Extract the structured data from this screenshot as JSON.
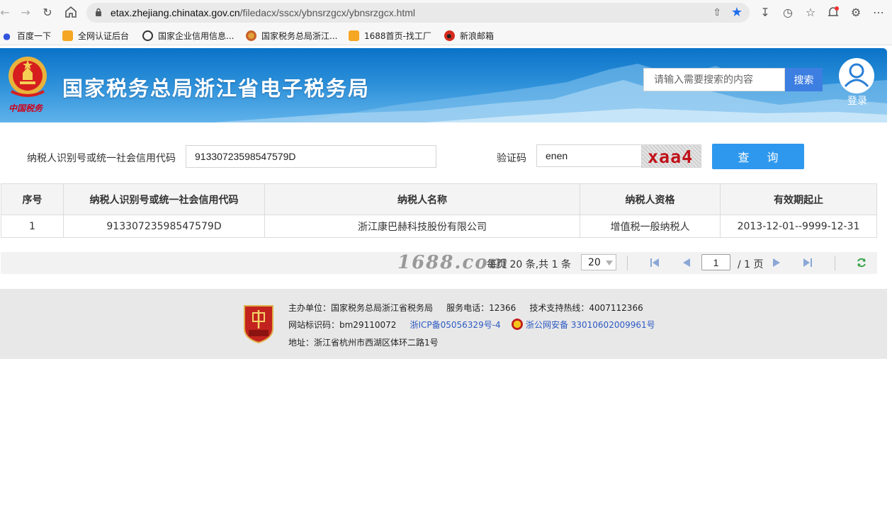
{
  "browser": {
    "url_host": "etax.zhejiang.chinatax.gov.cn",
    "url_path": "/filedacx/sscx/ybnsrzgcx/ybnsrzgcx.html",
    "nav_icons": [
      "back-icon",
      "forward-icon",
      "reload-icon",
      "home-icon"
    ],
    "toolbar_icons": [
      "download-icon",
      "history-icon",
      "favorites-icon",
      "notifications-icon",
      "extensions-icon",
      "more-icon"
    ],
    "bookmarks": [
      {
        "label": "百度一下",
        "icon": "baidu-icon",
        "color": "#3355dd"
      },
      {
        "label": "全网认证后台",
        "icon": "alibaba-icon",
        "color": "#f5a623"
      },
      {
        "label": "国家企业信用信息...",
        "icon": "globe-icon",
        "color": "#333333"
      },
      {
        "label": "国家税务总局浙江...",
        "icon": "tax-emblem-icon",
        "color": "#c8612a"
      },
      {
        "label": "1688首页-找工厂",
        "icon": "alibaba-icon",
        "color": "#f5a623"
      },
      {
        "label": "新浪邮箱",
        "icon": "weibo-icon",
        "color": "#d52b1e"
      }
    ]
  },
  "header": {
    "emblem_text": "中国税务",
    "title": "国家税务总局浙江省电子税务局",
    "search_placeholder": "请输入需要搜索的内容",
    "search_button": "搜索",
    "login_label": "登录"
  },
  "form": {
    "tax_id_label": "纳税人识别号或统一社会信用代码",
    "tax_id_value": "91330723598547579D",
    "captcha_label": "验证码",
    "captcha_value": "enen",
    "captcha_image_text": "xaa4",
    "query_button": "查 询"
  },
  "table": {
    "headers": [
      "序号",
      "纳税人识别号或统一社会信用代码",
      "纳税人名称",
      "纳税人资格",
      "有效期起止"
    ],
    "rows": [
      [
        "1",
        "91330723598547579D",
        "浙江康巴赫科技股份有限公司",
        "增值税一般纳税人",
        "2013-12-01--9999-12-31"
      ]
    ]
  },
  "pager": {
    "watermark": "1688.com",
    "info": "每页 20 条,共 1 条",
    "page_size": "20",
    "current_page": "1",
    "total_pages": "/ 1 页"
  },
  "footer": {
    "badge_text": "党政机关",
    "sponsor": "主办单位：国家税务总局浙江省税务局",
    "service_phone": "服务电话：12366",
    "support_hotline": "技术支持热线：4007112366",
    "site_id": "网站标识码：bm29110072",
    "icp": "浙ICP备05056329号-4",
    "police": "浙公网安备 33010602009961号",
    "address": "地址：浙江省杭州市西湖区体环二路1号"
  },
  "colors": {
    "header_blue": "#0a72c8",
    "query_button": "#2e98ee",
    "search_button": "#3d7ee1",
    "link": "#2b59c3"
  }
}
